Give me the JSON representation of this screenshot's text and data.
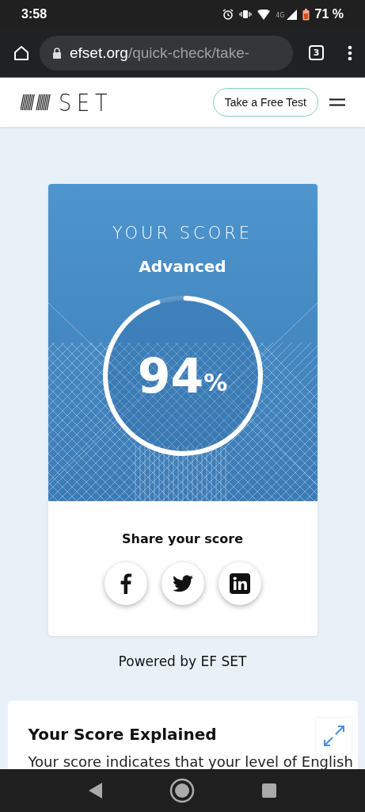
{
  "status_bar": {
    "time": "3:58",
    "network": "4G",
    "battery": "71 %"
  },
  "browser": {
    "url_domain": "efset.org",
    "url_path": "/quick-check/take-",
    "tab_count": "3"
  },
  "header": {
    "logo_text": "SET",
    "cta": "Take a Free Test"
  },
  "score_card": {
    "heading": "YOUR SCORE",
    "level_name": "Advanced",
    "score": "94",
    "unit": "%",
    "level": 0.94,
    "share_label": "Share your score"
  },
  "powered_by": "Powered by EF SET",
  "explained": {
    "title": "Your Score Explained",
    "text": "Your score indicates that your level of English"
  }
}
